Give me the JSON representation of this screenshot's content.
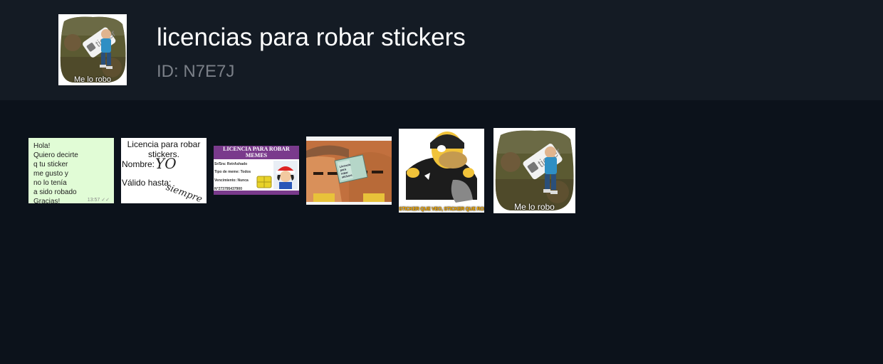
{
  "pack": {
    "title": "licencias para robar stickers",
    "id_label": "ID: N7E7J",
    "thumb_caption": "Me lo robo"
  },
  "stickers": [
    {
      "name": "whatsapp-message-sticker",
      "text": "Hola!\nQuiero decirte\nq tu sticker\nme gusto y\nno lo tenía\na sido robado\nGracias!",
      "time": "13:57 ✓✓"
    },
    {
      "name": "license-handwritten-sticker",
      "title": "Licencia para robar stickers.",
      "field1_label": "Nombre:",
      "field1_value": "YO",
      "field2_label": "Válido hasta:",
      "field2_value": "siempre"
    },
    {
      "name": "id-card-sticker",
      "title": "LICENCIA PARA ROBAR MEMES",
      "row1": "Sr/Sra: RetrAshado",
      "row2": "Tipo de meme: Todos",
      "row3": "Vencimiento: Nunca",
      "row4": "N°273795437900"
    },
    {
      "name": "cartoon-license-sticker",
      "card_text": "Licencia para robar stickers"
    },
    {
      "name": "simpson-sticker",
      "caption": "STICKER QUE VEO, STICKER QUE ROBO"
    },
    {
      "name": "baby-sticker",
      "caption": "Me lo robo"
    }
  ],
  "colors": {
    "page_background": "#0c121b",
    "header_background": "#141b24",
    "title_text": "#ffffff",
    "id_text": "#7b8088"
  }
}
